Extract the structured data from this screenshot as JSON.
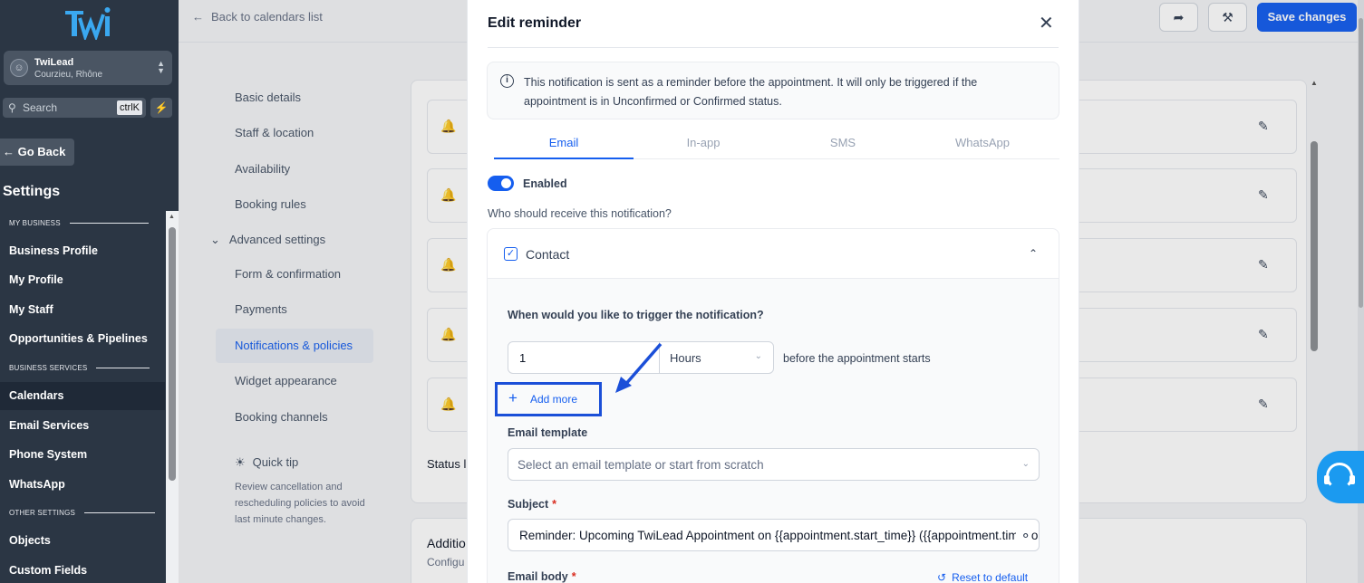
{
  "sidebar": {
    "logo_text": "TWI",
    "account": {
      "name": "TwiLead",
      "location": "Courzieu, Rhône"
    },
    "search": {
      "placeholder": "Search",
      "shortcut": "ctrlK"
    },
    "go_back": "Go Back",
    "title": "Settings",
    "sections": [
      {
        "label": "MY BUSINESS"
      },
      {
        "label": "BUSINESS SERVICES"
      },
      {
        "label": "OTHER SETTINGS"
      }
    ],
    "items": [
      {
        "label": "Business Profile"
      },
      {
        "label": "My Profile"
      },
      {
        "label": "My Staff"
      },
      {
        "label": "Opportunities & Pipelines"
      },
      {
        "label": "Calendars"
      },
      {
        "label": "Email Services"
      },
      {
        "label": "Phone System"
      },
      {
        "label": "WhatsApp"
      },
      {
        "label": "Objects"
      },
      {
        "label": "Custom Fields"
      }
    ]
  },
  "topbar": {
    "back_label": "Back to calendars list",
    "save_label": "Save changes"
  },
  "calendar_nav": {
    "items": [
      {
        "label": "Basic details"
      },
      {
        "label": "Staff & location"
      },
      {
        "label": "Availability"
      },
      {
        "label": "Booking rules"
      },
      {
        "label": "Advanced settings"
      },
      {
        "label": "Form & confirmation"
      },
      {
        "label": "Payments"
      },
      {
        "label": "Notifications & policies"
      },
      {
        "label": "Widget appearance"
      },
      {
        "label": "Booking channels"
      }
    ],
    "tip_title": "Quick tip",
    "tip_body": "Review cancellation and rescheduling policies to avoid last minute changes."
  },
  "background": {
    "status_label": "Status l",
    "additional_title": "Additio",
    "additional_sub": "Configu"
  },
  "modal": {
    "title": "Edit reminder",
    "info": "This notification is sent as a reminder before the appointment. It will only be triggered if the appointment is in Unconfirmed or Confirmed status.",
    "tabs": [
      {
        "label": "Email"
      },
      {
        "label": "In-app"
      },
      {
        "label": "SMS"
      },
      {
        "label": "WhatsApp"
      }
    ],
    "enabled_label": "Enabled",
    "recipient_question": "Who should receive this notification?",
    "recipient": "Contact",
    "trigger_question": "When would you like to trigger the notification?",
    "trigger_value": "1",
    "trigger_unit": "Hours",
    "trigger_suffix": "before the appointment starts",
    "add_more": "Add more",
    "template_label": "Email template",
    "template_placeholder": "Select an email template or start from scratch",
    "subject_label": "Subject",
    "subject_value": "Reminder: Upcoming TwiLead Appointment on {{appointment.start_time}} ({{appointment.timezone}})",
    "body_label": "Email body",
    "reset_label": "Reset to default"
  },
  "colors": {
    "accent": "#155eef",
    "sidebar": "#2b3644",
    "highlight_box": "#1b4fd8"
  }
}
